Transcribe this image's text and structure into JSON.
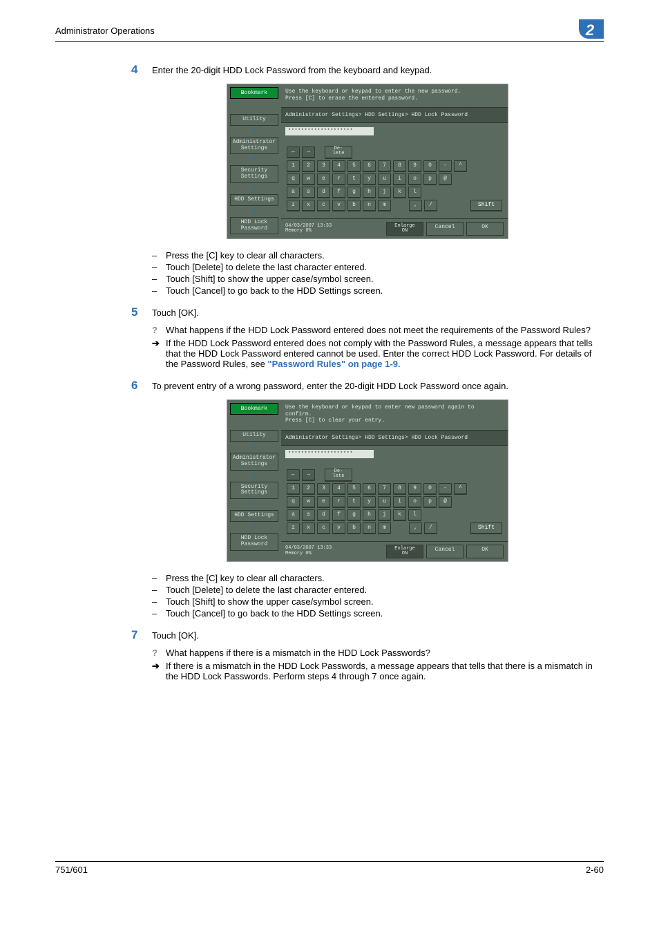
{
  "header": {
    "title": "Administrator Operations",
    "chapter": "2"
  },
  "steps": {
    "s4": {
      "num": "4",
      "text": "Enter the 20-digit HDD Lock Password from the keyboard and keypad.",
      "bullets": [
        "Press the [C] key to clear all characters.",
        "Touch [Delete] to delete the last character entered.",
        "Touch [Shift] to show the upper case/symbol screen.",
        "Touch [Cancel] to go back to the HDD Settings screen."
      ]
    },
    "s5": {
      "num": "5",
      "text": "Touch [OK].",
      "q": "What happens if the HDD Lock Password entered does not meet the requirements of the Password Rules?",
      "a_pre": "If the HDD Lock Password entered does not comply with the Password Rules, a message appears that tells that the HDD Lock Password entered cannot be used. Enter the correct HDD Lock Password. For details of the Password Rules, see ",
      "a_link": "\"Password Rules\" on page 1-9",
      "a_post": "."
    },
    "s6": {
      "num": "6",
      "text": "To prevent entry of a wrong password, enter the 20-digit HDD Lock Password once again.",
      "bullets": [
        "Press the [C] key to clear all characters.",
        "Touch [Delete] to delete the last character entered.",
        "Touch [Shift] to show the upper case/symbol screen.",
        "Touch [Cancel] to go back to the HDD Settings screen."
      ]
    },
    "s7": {
      "num": "7",
      "text": "Touch [OK].",
      "q": "What happens if there is a mismatch in the HDD Lock Passwords?",
      "a": "If there is a mismatch in the HDD Lock Passwords, a message appears that tells that there is a mismatch in the HDD Lock Passwords. Perform steps 4 through 7 once again."
    }
  },
  "panel": {
    "msg1": "Use the keyboard or keypad to enter the new password.\nPress [C] to erase the entered password.",
    "msg2": "Use the keyboard or keypad to enter new password again to confirm.\nPress [C] to clear your entry.",
    "breadcrumb": "Administrator Settings> HDD Settings> HDD Lock Password",
    "password": "********************",
    "nav": {
      "bookmark": "Bookmark",
      "utility": "Utility",
      "admin": "Administrator\nSettings",
      "security": "Security\nSettings",
      "hdd": "HDD Settings",
      "lock": "HDD Lock\nPassword"
    },
    "keys": {
      "delete": "De-\nlete",
      "row1": [
        "1",
        "2",
        "3",
        "4",
        "5",
        "6",
        "7",
        "8",
        "9",
        "0",
        "-",
        "^"
      ],
      "row2": [
        "q",
        "w",
        "e",
        "r",
        "t",
        "y",
        "u",
        "i",
        "o",
        "p",
        "@"
      ],
      "row3": [
        "a",
        "s",
        "d",
        "f",
        "g",
        "h",
        "j",
        "k",
        "l"
      ],
      "row4": [
        "z",
        "x",
        "c",
        "v",
        "b",
        "n",
        "m"
      ],
      "punct": [
        ",",
        "/"
      ],
      "shift": "Shift"
    },
    "status": {
      "date": "04/03/2007",
      "time": "13:33",
      "mem": "Memory",
      "pct": "0%",
      "enlarge": "Enlarge\nON",
      "cancel": "Cancel",
      "ok": "OK"
    }
  },
  "footer": {
    "left": "751/601",
    "right": "2-60"
  }
}
